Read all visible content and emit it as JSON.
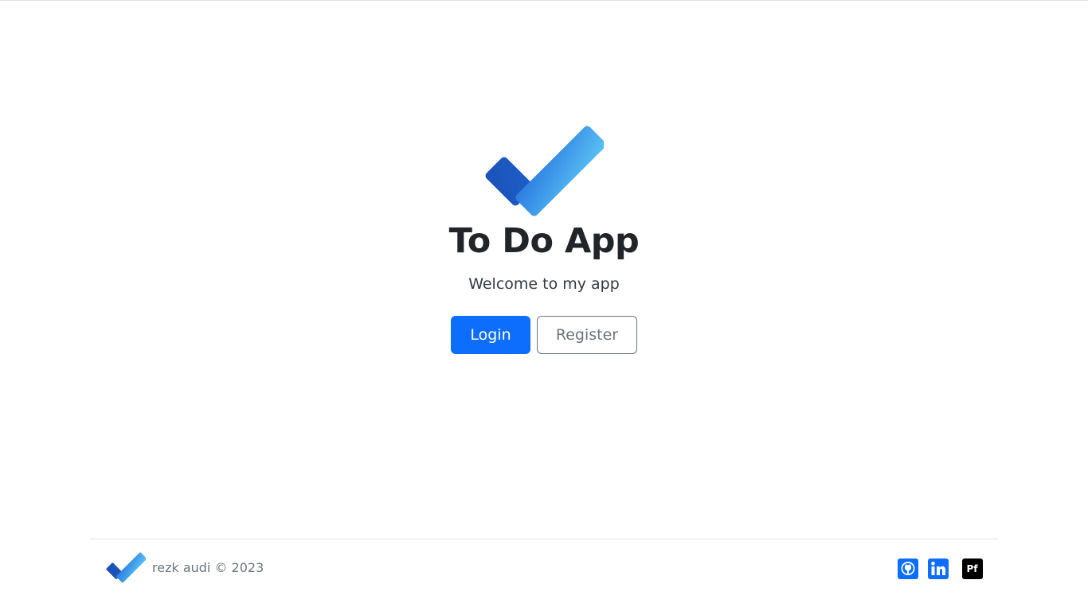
{
  "app": {
    "title": "To Do App",
    "subtitle": "Welcome to my app",
    "logo_icon": "checkmark-logo-icon"
  },
  "actions": {
    "login_label": "Login",
    "register_label": "Register"
  },
  "footer": {
    "copyright": "rezk audi © 2023",
    "logo_icon": "checkmark-logo-icon",
    "social": [
      {
        "name": "github-icon",
        "label": ""
      },
      {
        "name": "linkedin-icon",
        "label": ""
      },
      {
        "name": "portfolio-icon",
        "label": "Pf"
      }
    ]
  },
  "colors": {
    "primary": "#0d6efd",
    "secondary": "#6c757d",
    "logo_dark": "#185abd",
    "logo_light": "#5ac2f5"
  }
}
